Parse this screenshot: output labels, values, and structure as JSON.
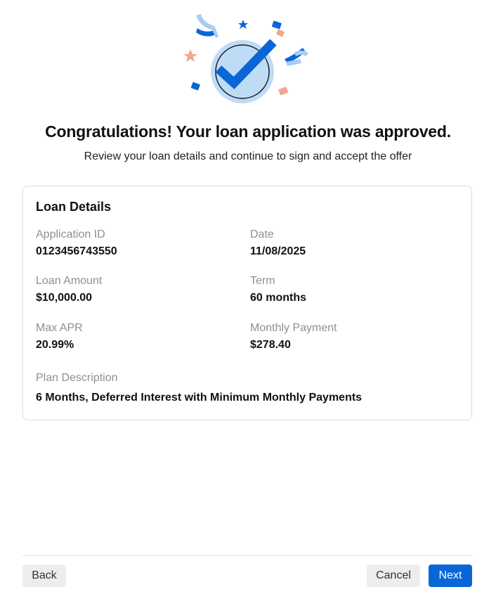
{
  "header": {
    "icon": "approved-check-celebration-icon",
    "title": "Congratulations! Your loan application was approved.",
    "subtitle": "Review your loan details and continue to sign and accept the offer"
  },
  "loan_details": {
    "title": "Loan Details",
    "fields": {
      "application_id": {
        "label": "Application ID",
        "value": "0123456743550"
      },
      "date": {
        "label": "Date",
        "value": "11/08/2025"
      },
      "loan_amount": {
        "label": "Loan Amount",
        "value": "$10,000.00"
      },
      "term": {
        "label": "Term",
        "value": "60 months"
      },
      "max_apr": {
        "label": "Max APR",
        "value": "20.99%"
      },
      "monthly_payment": {
        "label": "Monthly Payment",
        "value": "$278.40"
      },
      "plan_description": {
        "label": "Plan Description",
        "value": "6 Months, Deferred Interest with Minimum Monthly Payments"
      }
    }
  },
  "footer": {
    "back_label": "Back",
    "cancel_label": "Cancel",
    "next_label": "Next"
  },
  "colors": {
    "primary": "#0a66d6",
    "check_circle_fill": "#bfdcf7",
    "confetti_salmon": "#f2a693",
    "confetti_light_blue": "#a9cdf2",
    "card_border": "#d9dbe0"
  }
}
